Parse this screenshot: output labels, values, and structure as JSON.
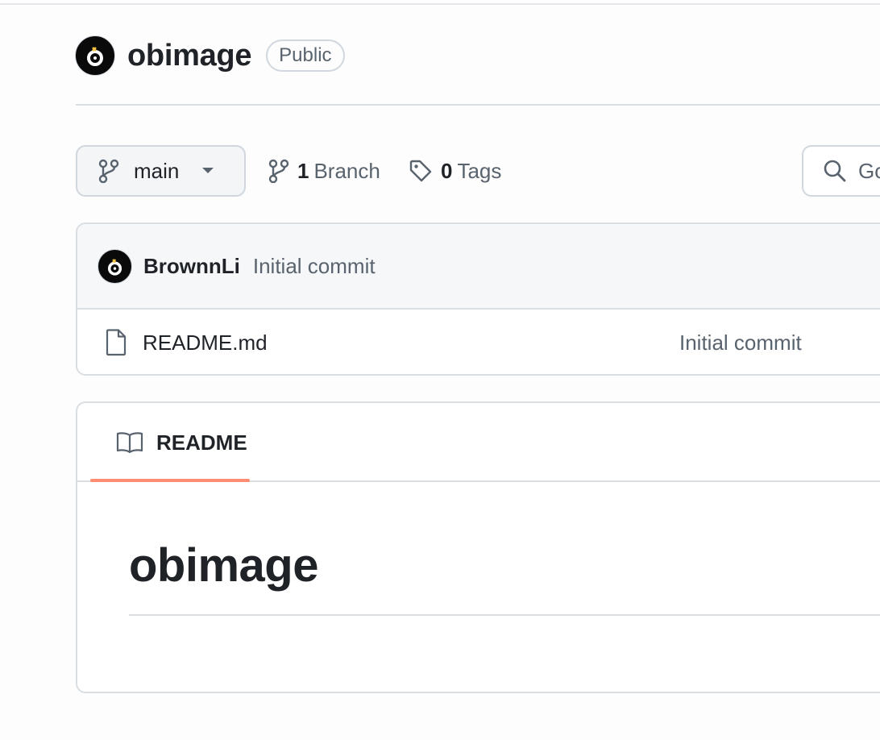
{
  "repo": {
    "name": "obimage",
    "visibility": "Public"
  },
  "toolbar": {
    "branch": "main",
    "branch_count": "1",
    "branch_label": "Branch",
    "tag_count": "0",
    "tag_label": "Tags",
    "search_placeholder": "Go to file"
  },
  "latest_commit": {
    "author": "BrownnLi",
    "message": "Initial commit"
  },
  "files": [
    {
      "name": "README.md",
      "commit_message": "Initial commit",
      "icon": "file-icon"
    }
  ],
  "readme": {
    "tab_label": "README",
    "heading": "obimage"
  },
  "colors": {
    "accent_underline": "#fd8c73",
    "avatar_bg": "#0a0a0a",
    "avatar_mark": "#f5c542"
  }
}
